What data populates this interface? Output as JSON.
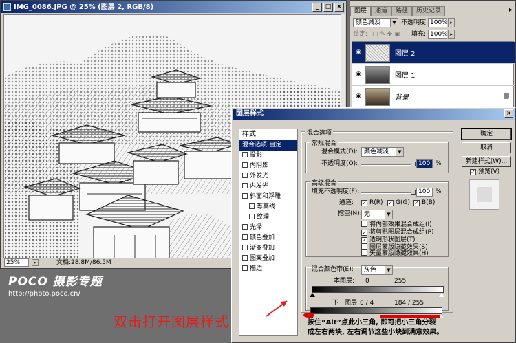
{
  "document": {
    "title": "IMG_0086.JPG @ 25% (图层 2, RGB/8)",
    "zoom": "25%",
    "doc_size": "文档:28.8M/86.5M",
    "min_btn": "_",
    "max_btn": "□",
    "close_btn": "×"
  },
  "watermark": {
    "brand": "POCO 摄影专题",
    "url": "http://photo.poco.cn/"
  },
  "layers_panel": {
    "tabs": [
      "图层",
      "通道",
      "路径",
      "历史记录"
    ],
    "blend_mode": "颜色减淡",
    "opacity_label": "不透明度:",
    "opacity_value": "100%",
    "lock_label": "锁定:",
    "fill_label": "填充:",
    "fill_value": "100%",
    "layers": [
      {
        "name": "图层 2",
        "selected": true
      },
      {
        "name": "图层 1",
        "selected": false
      },
      {
        "name": "背景",
        "selected": false,
        "locked": true
      }
    ]
  },
  "dialog": {
    "title": "图层样式",
    "close": "×",
    "styles_header": "样式",
    "styles": [
      {
        "label": "混合选项:自定",
        "current": true,
        "checkbox": false,
        "indent": false
      },
      {
        "label": "投影",
        "checkbox": true,
        "indent": false
      },
      {
        "label": "内阴影",
        "checkbox": true,
        "indent": false
      },
      {
        "label": "外发光",
        "checkbox": true,
        "indent": false
      },
      {
        "label": "内发光",
        "checkbox": true,
        "indent": false
      },
      {
        "label": "斜面和浮雕",
        "checkbox": true,
        "indent": false
      },
      {
        "label": "等高线",
        "checkbox": true,
        "indent": true
      },
      {
        "label": "纹理",
        "checkbox": true,
        "indent": true
      },
      {
        "label": "光泽",
        "checkbox": true,
        "indent": false
      },
      {
        "label": "颜色叠加",
        "checkbox": true,
        "indent": false
      },
      {
        "label": "渐变叠加",
        "checkbox": true,
        "indent": false
      },
      {
        "label": "图案叠加",
        "checkbox": true,
        "indent": false
      },
      {
        "label": "描边",
        "checkbox": true,
        "indent": false
      }
    ],
    "blend_options_title": "混合选项",
    "general_title": "常规混合",
    "blend_mode_label": "混合模式(D):",
    "blend_mode_value": "颜色减淡",
    "opacity_label": "不透明度(O):",
    "opacity_value": "100",
    "percent": "%",
    "advanced_title": "高级混合",
    "fill_opacity_label": "填充不透明度(F):",
    "fill_opacity_value": "100",
    "channels_label": "通道:",
    "channel_r": "R(R)",
    "channel_g": "G(G)",
    "channel_b": "B(B)",
    "knockout_label": "挖空(N):",
    "knockout_value": "无",
    "options": [
      {
        "label": "将内部效果混合成组(I)",
        "checked": false
      },
      {
        "label": "将剪贴图层混合成组(P)",
        "checked": true
      },
      {
        "label": "透明形状图层(T)",
        "checked": true
      },
      {
        "label": "图层蒙版隐藏效果(S)",
        "checked": false
      },
      {
        "label": "矢量蒙版隐藏效果(H)",
        "checked": false
      }
    ],
    "blend_if_label": "混合颜色带(E):",
    "blend_if_value": "灰色",
    "this_layer_label": "本图层:",
    "this_layer_min": "0",
    "this_layer_max": "255",
    "under_layer_label": "下一图层:",
    "under_layer_low": "0 / 4",
    "under_layer_high": "184 / 255",
    "ok": "确定",
    "cancel": "取消",
    "new_style": "新建样式(W)...",
    "preview": "预览(V)",
    "instruction_line1": "按住“Alt”点此小三角, 即可把小三角分裂",
    "instruction_line2": "成左右两块, 左右调节这些小块到满意效果。"
  },
  "annotation": {
    "text": "双击打开图层样式",
    "color": "#e02020"
  }
}
